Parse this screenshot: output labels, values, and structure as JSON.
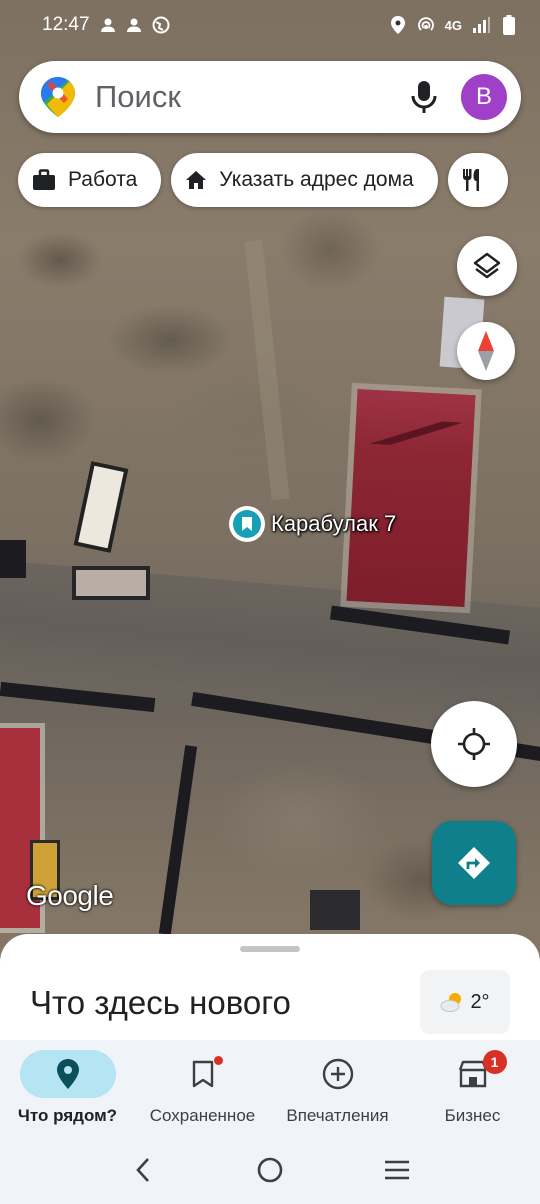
{
  "status_bar": {
    "time": "12:47",
    "network": "4G"
  },
  "search": {
    "placeholder": "Поиск",
    "avatar_letter": "В"
  },
  "chips": [
    {
      "label": "Работа",
      "icon": "briefcase-icon"
    },
    {
      "label": "Указать адрес дома",
      "icon": "home-icon"
    },
    {
      "label": "",
      "icon": "restaurant-icon"
    }
  ],
  "map": {
    "place_label": "Карабулак 7",
    "provider_logo": "Google"
  },
  "bottom_sheet": {
    "title": "Что здесь нового",
    "weather_temp": "2°"
  },
  "bottom_nav": {
    "items": [
      {
        "label": "Что рядом?",
        "icon": "location-pin-icon",
        "active": true
      },
      {
        "label": "Сохраненное",
        "icon": "bookmark-icon"
      },
      {
        "label": "Впечатления",
        "icon": "add-circle-icon"
      },
      {
        "label": "Бизнес",
        "icon": "store-icon",
        "badge": "1"
      }
    ]
  },
  "colors": {
    "accent_teal": "#0f7f8c",
    "avatar": "#a040c8",
    "active_pill": "#b5e4f2",
    "badge_red": "#d93025"
  }
}
